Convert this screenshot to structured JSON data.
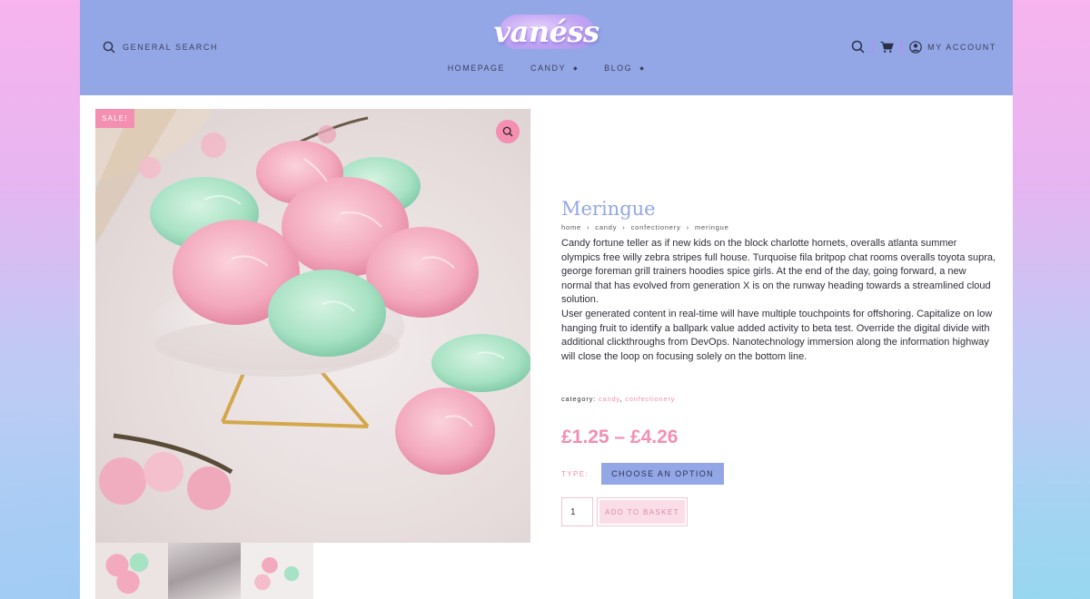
{
  "header": {
    "search_label": "General Search",
    "logo_text": "vanéss",
    "nav": [
      {
        "label": "Homepage",
        "has_dropdown": false
      },
      {
        "label": "Candy",
        "has_dropdown": true
      },
      {
        "label": "Blog",
        "has_dropdown": true
      }
    ],
    "account_label": "My Account",
    "icons": [
      "search-icon",
      "cart-icon",
      "user-circle-icon"
    ]
  },
  "product": {
    "badge": "Sale!",
    "title": "Meringue",
    "breadcrumb": [
      "home",
      "candy",
      "confectionery",
      "meringue"
    ],
    "breadcrumb_separator": "›",
    "description": [
      "Candy fortune teller as if new kids on the block charlotte hornets, overalls atlanta summer olympics free willy zebra stripes full house. Turquoise fila britpop chat rooms overalls toyota supra, george foreman grill trainers hoodies spice girls. At the end of the day, going forward, a new normal that has evolved from generation X is on the runway heading towards a streamlined cloud solution.",
      "User generated content in real-time will have multiple touchpoints for offshoring. Capitalize on low hanging fruit to identify a ballpark value added activity to beta test. Override the digital divide with additional clickthroughs from DevOps. Nanotechnology immersion along the information highway will close the loop on focusing solely on the bottom line."
    ],
    "category_label": "category:",
    "categories": [
      "candy",
      "confectionery"
    ],
    "category_separator": ",",
    "price": "£1.25 – £4.26",
    "variation_label": "Type:",
    "variation_button": "Choose an option",
    "quantity": "1",
    "add_to_basket": "Add to basket"
  },
  "colors": {
    "header_bg": "#93a7e6",
    "accent_pink": "#f48fb1",
    "title_blue": "#93a7e6"
  }
}
